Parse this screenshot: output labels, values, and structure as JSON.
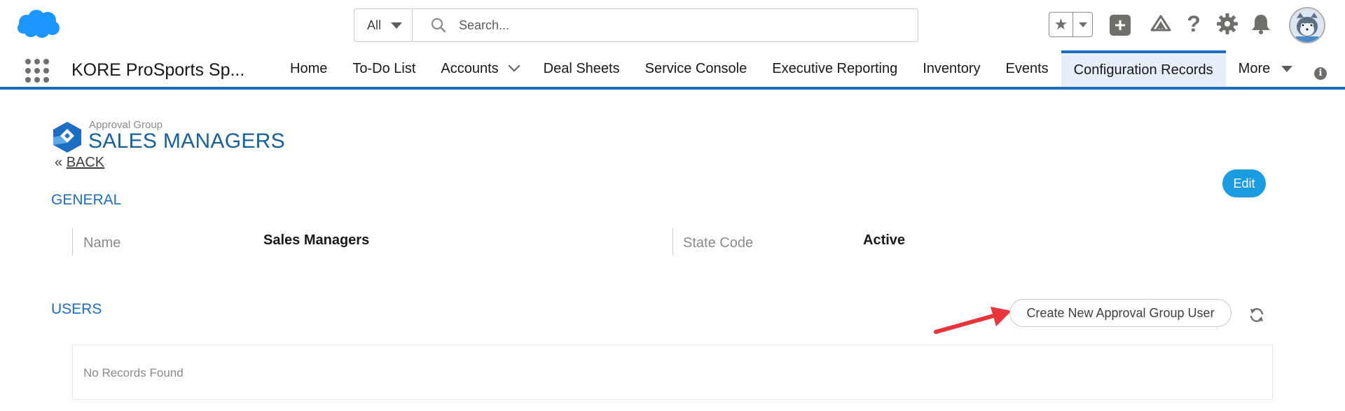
{
  "header": {
    "search": {
      "scope": "All",
      "placeholder": "Search..."
    }
  },
  "nav": {
    "app_name": "KORE ProSports Sp...",
    "tabs": [
      {
        "label": "Home"
      },
      {
        "label": "To-Do List"
      },
      {
        "label": "Accounts",
        "has_dropdown": true
      },
      {
        "label": "Deal Sheets"
      },
      {
        "label": "Service Console"
      },
      {
        "label": "Executive Reporting"
      },
      {
        "label": "Inventory"
      },
      {
        "label": "Events"
      },
      {
        "label": "Configuration Records",
        "active": true
      },
      {
        "label": "More",
        "has_dropdown": true
      }
    ]
  },
  "record": {
    "type": "Approval Group",
    "name": "SALES MANAGERS",
    "back_prefix": "«",
    "back_label": "BACK",
    "edit_label": "Edit"
  },
  "general": {
    "title": "GENERAL",
    "fields": [
      {
        "label": "Name",
        "value": "Sales Managers"
      },
      {
        "label": "State Code",
        "value": "Active"
      }
    ]
  },
  "users": {
    "title": "USERS",
    "create_label": "Create New Approval Group User",
    "empty_text": "No Records Found"
  },
  "colors": {
    "brand_blue": "#1b6ec2",
    "record_title": "#16609e",
    "edit_button": "#1b9be0",
    "annotation_arrow": "#e8343a"
  },
  "icons": [
    "salesforce-cloud-icon",
    "search-icon",
    "star-icon",
    "plus-icon",
    "trailhead-icon",
    "help-icon",
    "gear-icon",
    "bell-icon",
    "app-launcher-icon",
    "info-icon",
    "approval-group-icon",
    "refresh-icon"
  ]
}
